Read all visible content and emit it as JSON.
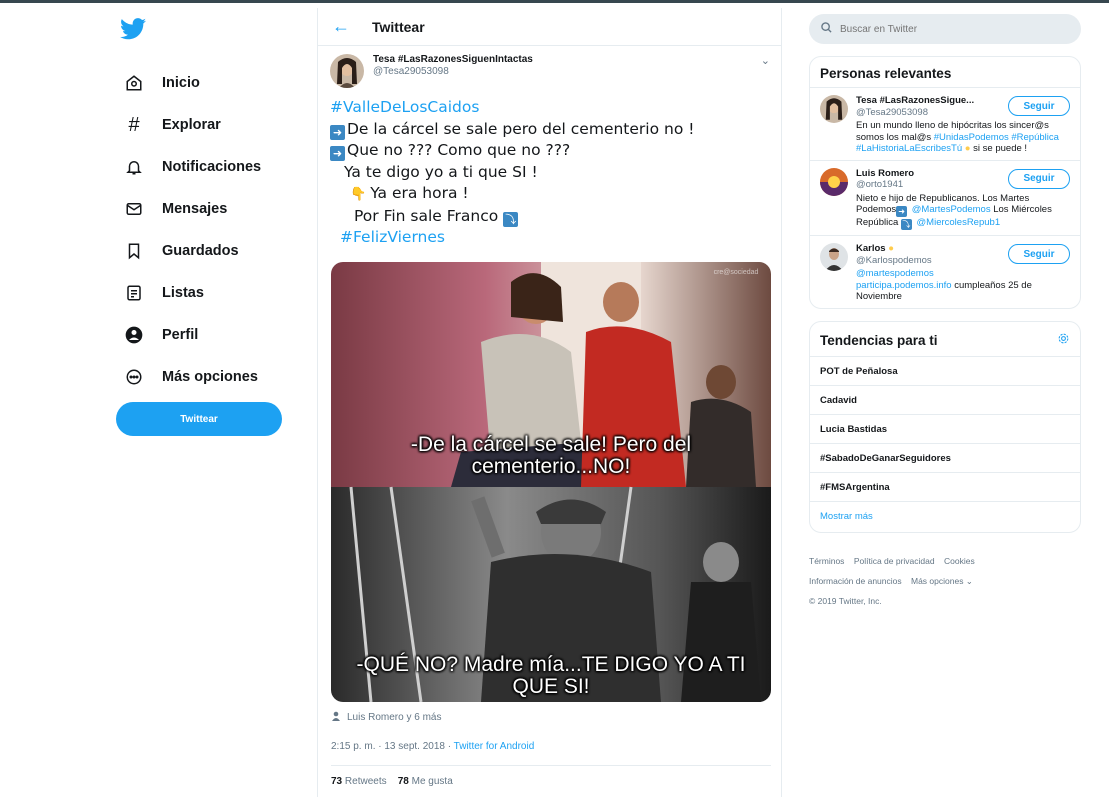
{
  "sidebar": {
    "nav": [
      {
        "label": "Inicio",
        "icon": "home-icon"
      },
      {
        "label": "Explorar",
        "icon": "hashtag-icon"
      },
      {
        "label": "Notificaciones",
        "icon": "bell-icon"
      },
      {
        "label": "Mensajes",
        "icon": "mail-icon"
      },
      {
        "label": "Guardados",
        "icon": "bookmark-icon"
      },
      {
        "label": "Listas",
        "icon": "list-icon"
      },
      {
        "label": "Perfil",
        "icon": "profile-icon"
      },
      {
        "label": "Más opciones",
        "icon": "more-icon"
      }
    ],
    "tweet_button": "Twittear"
  },
  "center": {
    "header_title": "Twittear",
    "tweet": {
      "author_name": "Tesa #LasRazonesSiguenIntactas",
      "author_handle": "@Tesa29053098",
      "lines": [
        "#ValleDeLosCaidos",
        "De la cárcel se sale pero del cementerio no !",
        "Que no ??? Como que no ???",
        "Ya te digo yo a ti que SI !",
        "Ya era hora !",
        "Por Fin sale Franco",
        "#FelizViernes"
      ],
      "image_caption_top": "-De la cárcel se sale! Pero del cementerio...NO!",
      "image_caption_bottom": "-QUÉ NO? Madre mía...TE DIGO YO A TI QUE SI!",
      "image_watermark": "cre@sociedad",
      "liked_by": "Luis Romero y 6 más",
      "timestamp": "2:15 p. m. · 13 sept. 2018 · ",
      "source": "Twitter for Android",
      "retweets_count": "73",
      "retweets_label": "Retweets",
      "likes_count": "78",
      "likes_label": "Me gusta"
    }
  },
  "right": {
    "search_placeholder": "Buscar en Twitter",
    "relevant_title": "Personas relevantes",
    "people": [
      {
        "name": "Tesa #LasRazonesSigue...",
        "handle": "@Tesa29053098",
        "bio": "En un mundo lleno de hipócritas los sincer@s somos los mal@s",
        "bio_links": "#UnidasPodemos #República #LaHistoriaLaEscribesTú",
        "bio_end": " si se puede !",
        "follow": "Seguir"
      },
      {
        "name": "Luis Romero",
        "handle": "@orto1941",
        "bio": "Nieto e hijo de Republicanos. Los Martes Podemos",
        "bio_link1": "@MartesPodemos",
        "bio_mid": " Los Miércoles República ",
        "bio_link2": "@MiercolesRepub1",
        "follow": "Seguir"
      },
      {
        "name": "Karlos",
        "handle": "@Karlospodemos",
        "bio_link1": "@martespodemos",
        "bio_link2": "participa.podemos.info",
        "bio_end": " cumpleaños 25 de Noviembre",
        "follow": "Seguir"
      }
    ],
    "trends_title": "Tendencias para ti",
    "trends": [
      "POT de Peñalosa",
      "Cadavid",
      "Lucia Bastidas",
      "#SabadoDeGanarSeguidores",
      "#FMSArgentina"
    ],
    "show_more": "Mostrar más",
    "footer": {
      "terms": "Términos",
      "privacy": "Política de privacidad",
      "cookies": "Cookies",
      "ads": "Información de anuncios",
      "more": "Más opciones ⌄",
      "copyright": "© 2019 Twitter, Inc."
    }
  },
  "colors": {
    "accent": "#1da1f2",
    "text": "#14171a",
    "secondary": "#657786",
    "border": "#e6ecf0"
  }
}
